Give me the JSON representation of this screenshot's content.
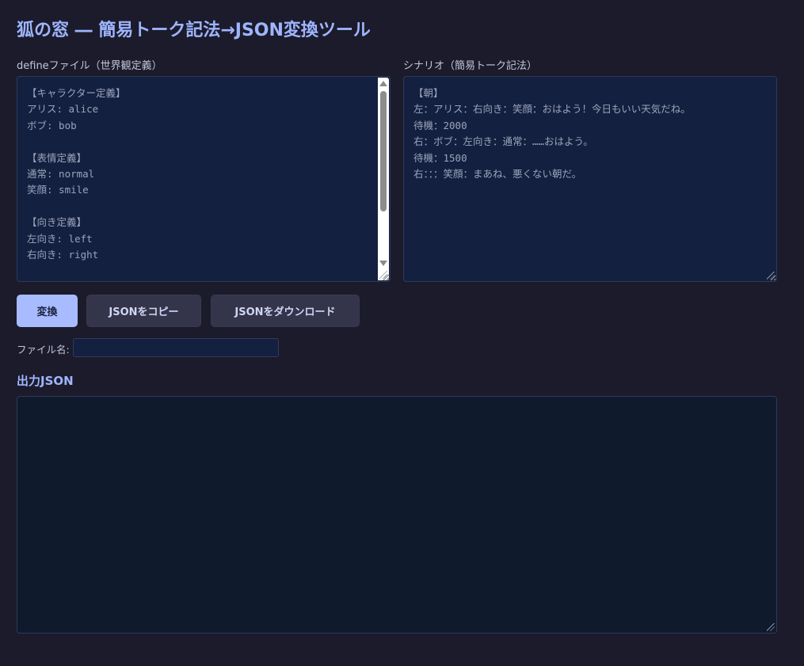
{
  "title": "狐の窓 ― 簡易トーク記法→JSON変換ツール",
  "define": {
    "label": "defineファイル（世界観定義）",
    "content": "【キャラクター定義】\nアリス: alice\nボブ: bob\n\n【表情定義】\n通常: normal\n笑顔: smile\n\n【向き定義】\n左向き: left\n右向き: right"
  },
  "scenario": {
    "label": "シナリオ（簡易トーク記法）",
    "content": "【朝】\n左：アリス：右向き：笑顔：おはよう！今日もいい天気だね。\n待機：2000\n右：ボブ：左向き：通常：……おはよう。\n待機：1500\n右：：：笑顔：まあね、悪くない朝だ。"
  },
  "buttons": {
    "convert": "変換",
    "copy": "JSONをコピー",
    "download": "JSONをダウンロード"
  },
  "filename": {
    "label": "ファイル名:",
    "value": ""
  },
  "output": {
    "title": "出力JSON",
    "content": ""
  },
  "colors": {
    "background": "#1b1b2b",
    "accent": "#9fb5ff",
    "primary_button": "#a9bbff"
  }
}
